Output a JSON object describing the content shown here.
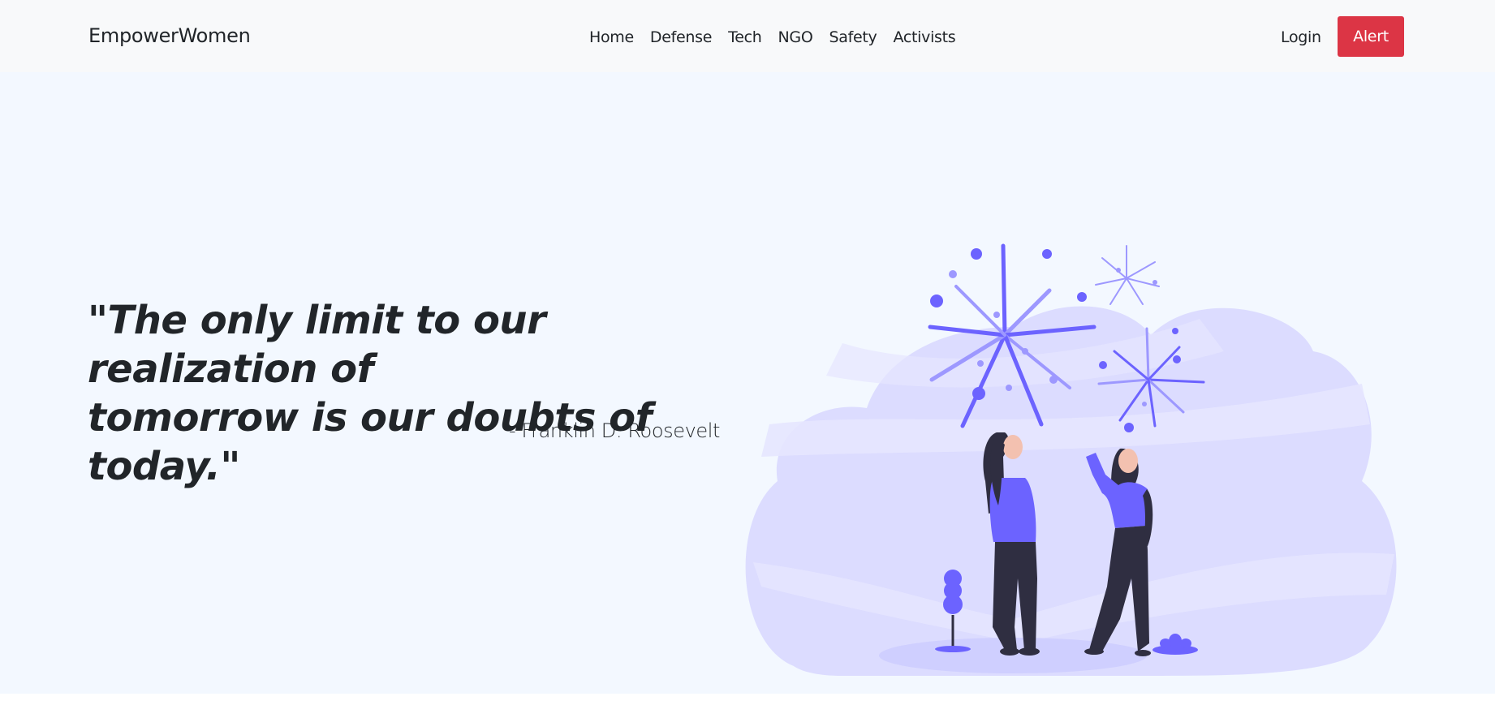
{
  "navbar": {
    "brand": "EmpowerWomen",
    "links": [
      "Home",
      "Defense",
      "Tech",
      "NGO",
      "Safety",
      "Activists"
    ],
    "login_label": "Login",
    "alert_label": "Alert"
  },
  "hero": {
    "quote_line1": "\"The only limit to our realization of",
    "quote_line2": "tomorrow is our doubts of today.\"",
    "author": "- Franklin D. Roosevelt",
    "illustration": "women-watching-fireworks-illustration"
  },
  "colors": {
    "alert": "#dc3545",
    "navbar_bg": "#f8f9fa",
    "hero_bg": "#f3f8ff",
    "illustration_primary": "#6c63ff",
    "illustration_cloud": "#dcdcff"
  }
}
